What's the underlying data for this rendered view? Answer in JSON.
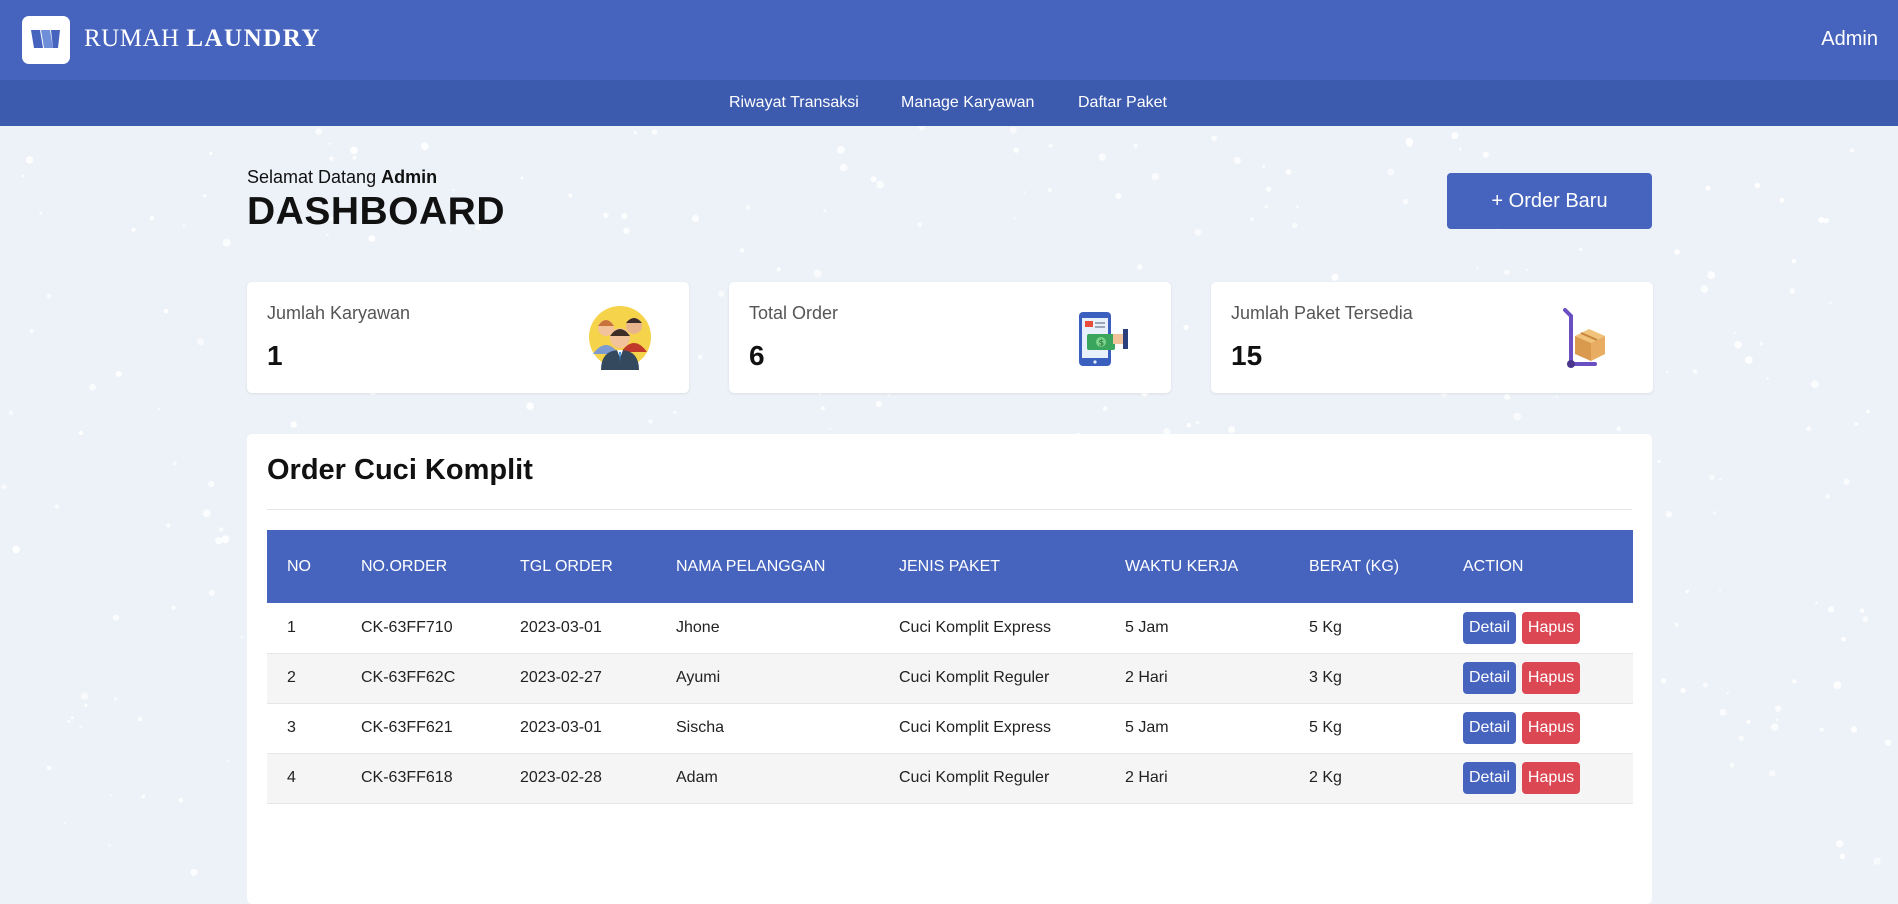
{
  "header": {
    "brand_light": "RUMAH",
    "brand_bold": "LAUNDRY",
    "user": "Admin"
  },
  "nav": {
    "items": [
      {
        "label": "Riwayat Transaksi"
      },
      {
        "label": "Manage Karyawan"
      },
      {
        "label": "Daftar Paket"
      }
    ]
  },
  "welcome": {
    "prefix": "Selamat Datang",
    "name": "Admin"
  },
  "page_title": "DASHBOARD",
  "new_order_button": "+ Order Baru",
  "stats": [
    {
      "label": "Jumlah Karyawan",
      "value": "1",
      "icon": "employees-icon"
    },
    {
      "label": "Total Order",
      "value": "6",
      "icon": "mobile-payment-icon"
    },
    {
      "label": "Jumlah Paket Tersedia",
      "value": "15",
      "icon": "package-trolley-icon"
    }
  ],
  "orders": {
    "title": "Order Cuci Komplit",
    "columns": [
      "NO",
      "NO.ORDER",
      "TGL ORDER",
      "NAMA PELANGGAN",
      "JENIS PAKET",
      "WAKTU KERJA",
      "BERAT (KG)",
      "ACTION"
    ],
    "rows": [
      [
        "1",
        "CK-63FF710",
        "2023-03-01",
        "Jhone",
        "Cuci Komplit Express",
        "5 Jam",
        "5 Kg"
      ],
      [
        "2",
        "CK-63FF62C",
        "2023-02-27",
        "Ayumi",
        "Cuci Komplit Reguler",
        "2 Hari",
        "3 Kg"
      ],
      [
        "3",
        "CK-63FF621",
        "2023-03-01",
        "Sischa",
        "Cuci Komplit Express",
        "5 Jam",
        "5 Kg"
      ],
      [
        "4",
        "CK-63FF618",
        "2023-02-28",
        "Adam",
        "Cuci Komplit Reguler",
        "2 Hari",
        "2 Kg"
      ]
    ],
    "detail_label": "Detail",
    "delete_label": "Hapus"
  },
  "colors": {
    "primary": "#4664be",
    "subnav": "#3c5aae",
    "danger": "#dc4754",
    "background": "#edf2f8"
  }
}
